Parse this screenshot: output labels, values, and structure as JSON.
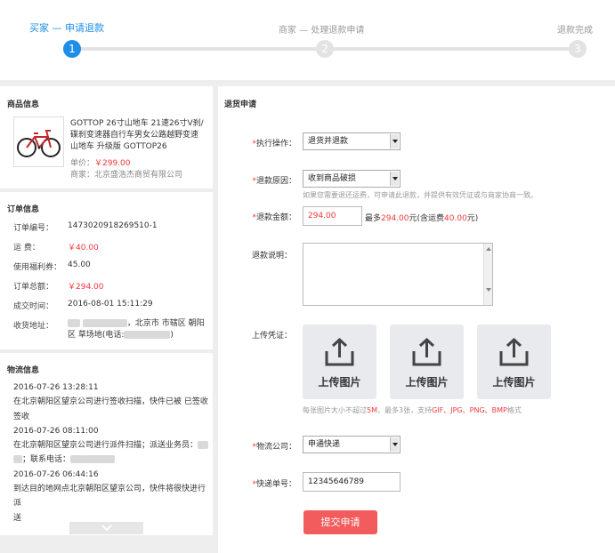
{
  "steps": [
    {
      "label": "买家 — 申请退款",
      "number": "1"
    },
    {
      "label": "商家 — 处理退款申请",
      "number": "2"
    },
    {
      "label": "退款完成",
      "number": "3"
    }
  ],
  "product": {
    "section_title": "商品信息",
    "name": "GOTTOP 26寸山地车 21速26寸V刹/碟刹变速器自行车男女公路越野变速山地车 升级版 GOTTOP26",
    "price_label": "单价：",
    "price": "￥299.00",
    "seller_label": "商家：",
    "seller": "北京盛浩杰商贸有限公司"
  },
  "order": {
    "section_title": "订单信息",
    "rows": [
      {
        "label": "订单编号：",
        "value": "1473020918269510-1"
      },
      {
        "label": "运  费：",
        "value": "￥40.00"
      },
      {
        "label": "使用福利券：",
        "value": "45.00"
      },
      {
        "label": "订单总额：",
        "value": "￥294.00"
      },
      {
        "label": "成交时间：",
        "value": "2016-08-01 15:11:29"
      },
      {
        "label": "收货地址：",
        "value": "，北京市 市辖区 朝阳",
        "value2": "区 草场地(电话:",
        "value2_end": ")"
      }
    ]
  },
  "logistics": {
    "section_title": "物流信息",
    "lines": [
      "2016-07-26 13:28:11",
      "在北京朝阳区望京公司进行签收扫描，快件已被 已签收",
      "签收",
      "2016-07-26 08:11:00",
      "在北京朝阳区望京公司进行派件扫描；派送业务员：",
      "；联系电话：",
      "2016-07-26 06:44:16",
      "到达目的地网点北京朝阳区望京公司，快件将很快进行派",
      "送"
    ]
  },
  "form": {
    "title": "退货申请",
    "action_label": "执行操作：",
    "action_value": "退货并退款",
    "reason_label": "退款原因：",
    "reason_value": "收到商品破损",
    "reason_hint": "如果您需要退还运费，可申请此退款，并提供有效凭证或与商家协商一致。",
    "amount_label": "退款金额：",
    "amount_value": "294.00",
    "amount_max_prefix": "最多",
    "amount_max": "294.00",
    "amount_max_mid": "元(含运费",
    "amount_shipping": "40.00",
    "amount_max_suffix": "元)",
    "desc_label": "退款说明：",
    "upload_label": "上传凭证：",
    "upload_text": "上传图片",
    "upload_hint_pre": "每张图片大小不超过",
    "upload_hint_size": "5M",
    "upload_hint_mid": "，最多3张，支持",
    "upload_hint_formats": "GIF、JPG、PNG、BMP",
    "upload_hint_suffix": "格式",
    "carrier_label": "物流公司：",
    "carrier_value": "申通快递",
    "tracking_label": "快递单号：",
    "tracking_value": "12345646789",
    "submit": "提交申请"
  },
  "colors": {
    "accent": "#1e8ee6",
    "price": "#f0383c",
    "submit": "#f25c5c"
  }
}
